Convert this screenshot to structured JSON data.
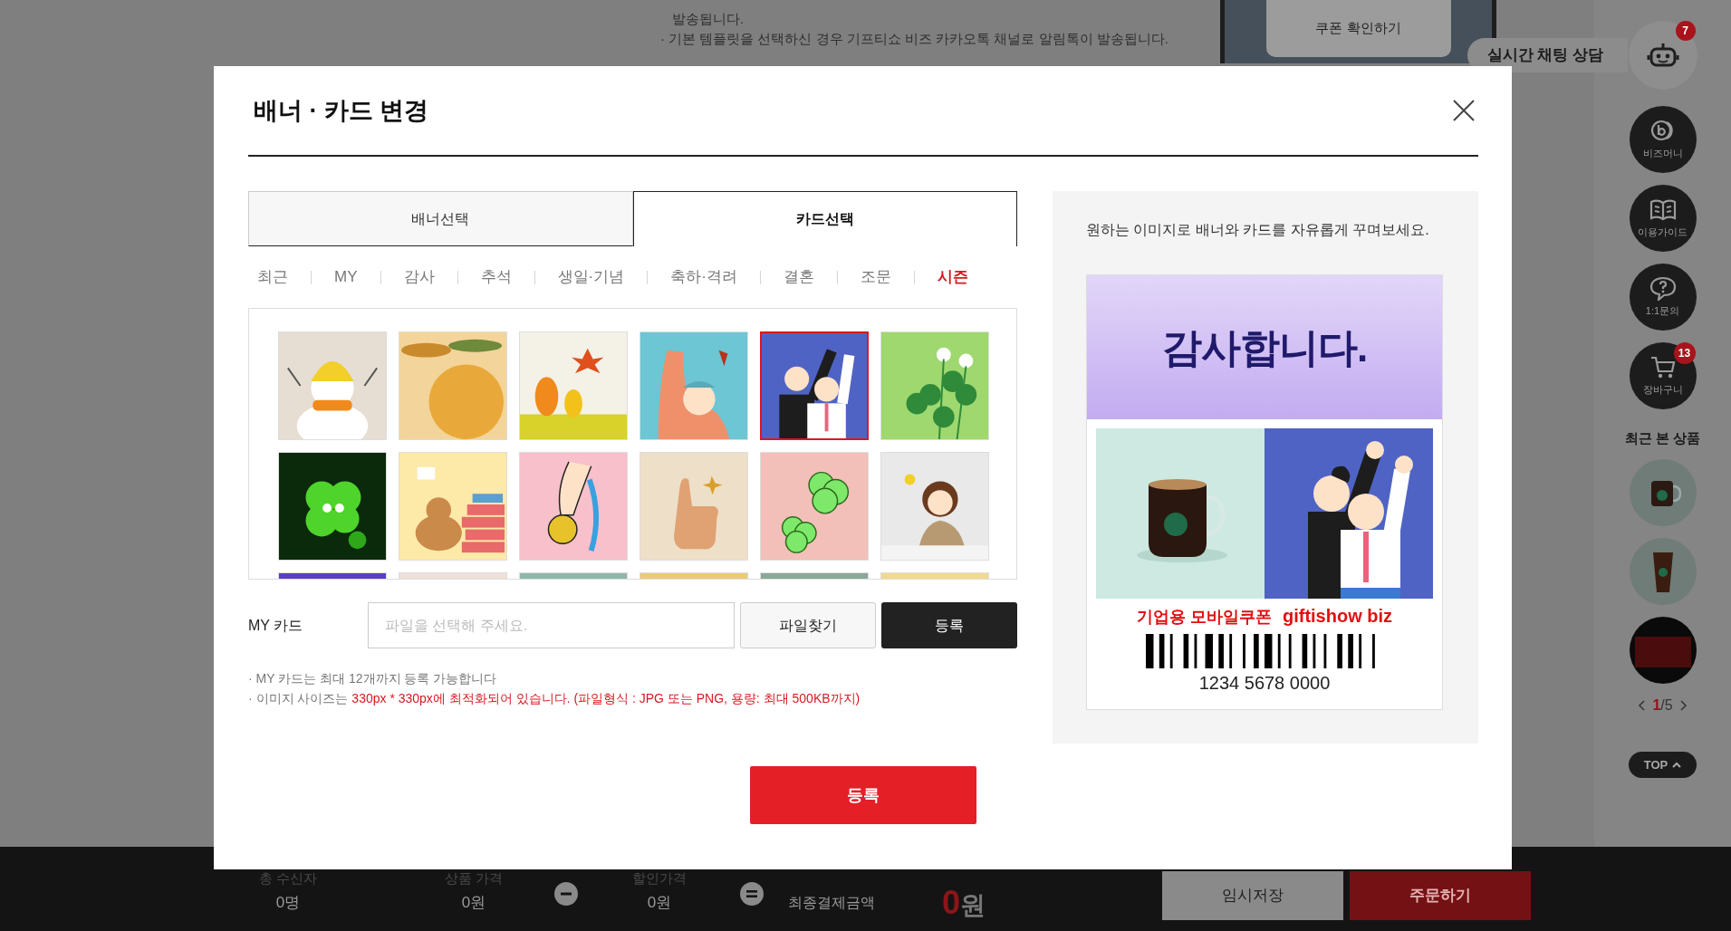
{
  "background_notice": {
    "lines": [
      "발송됩니다.",
      "· 기본 템플릿을 선택하신 경우 기프티쇼 비즈 카카오톡 채널로 알림톡이 발송됩니다."
    ],
    "coupon_check_button": "쿠폰 확인하기"
  },
  "chat": {
    "label": "실시간 채팅 상담",
    "badge": "7"
  },
  "quick_menu": [
    {
      "kind": "bizmoney",
      "label": "비즈머니"
    },
    {
      "kind": "guide",
      "label": "이용가이드"
    },
    {
      "kind": "inquiry",
      "label": "1:1문의"
    },
    {
      "kind": "cart",
      "label": "장바구니",
      "badge": "13"
    }
  ],
  "recent_products": {
    "title": "최근 본 상품",
    "items": [
      {
        "kind": "mug"
      },
      {
        "kind": "iced-coffee"
      },
      {
        "kind": "gift-card"
      }
    ],
    "pager": {
      "current": "1",
      "total": "/5"
    },
    "top_button": "TOP"
  },
  "modal": {
    "title": "배너 · 카드 변경",
    "tabs": [
      {
        "label": "배너선택",
        "selected": false
      },
      {
        "label": "카드선택",
        "selected": true
      }
    ],
    "categories": [
      {
        "label": "최근",
        "selected": false
      },
      {
        "label": "MY",
        "selected": false
      },
      {
        "label": "감사",
        "selected": false
      },
      {
        "label": "추석",
        "selected": false
      },
      {
        "label": "생일·기념",
        "selected": false
      },
      {
        "label": "축하·격려",
        "selected": false
      },
      {
        "label": "결혼",
        "selected": false
      },
      {
        "label": "조문",
        "selected": false
      },
      {
        "label": "시즌",
        "selected": true
      }
    ],
    "cards": [
      {
        "kind": "snowman",
        "selected": false
      },
      {
        "kind": "autumn-hello",
        "selected": false
      },
      {
        "kind": "autumn-trees",
        "selected": false
      },
      {
        "kind": "fist-leaf",
        "selected": false
      },
      {
        "kind": "cheering-pair",
        "selected": true
      },
      {
        "kind": "clover-field",
        "selected": false
      },
      {
        "kind": "clover-character",
        "selected": false
      },
      {
        "kind": "bear-books",
        "selected": false
      },
      {
        "kind": "medal",
        "selected": false
      },
      {
        "kind": "thumbs-up",
        "selected": false
      },
      {
        "kind": "smiling-clovers",
        "selected": false
      },
      {
        "kind": "studying-girl",
        "selected": false
      },
      {
        "kind": "violet",
        "selected": false
      },
      {
        "kind": "blush",
        "selected": false
      },
      {
        "kind": "teal",
        "selected": false
      },
      {
        "kind": "mustard",
        "selected": false
      },
      {
        "kind": "sage",
        "selected": false
      },
      {
        "kind": "sand",
        "selected": false
      }
    ],
    "my_card": {
      "label": "MY 카드",
      "placeholder": "파일을 선택해 주세요.",
      "browse_button": "파일찾기",
      "register_button": "등록"
    },
    "notes": [
      {
        "segments": [
          {
            "text": "· MY 카드는 최대 12개까지 등록 가능합니다",
            "highlight": false
          }
        ]
      },
      {
        "segments": [
          {
            "text": "· 이미지 사이즈는 ",
            "highlight": false
          },
          {
            "text": "330px * 330px에 최적화되어 있습니다. (파일형식 : JPG 또는 PNG, 용량: 최대 500KB까지)",
            "highlight": true
          }
        ]
      }
    ],
    "submit_button": "등록",
    "preview": {
      "description": "원하는 이미지로 배너와 카드를 자유롭게 꾸며보세요.",
      "banner_text": "감사합니다.",
      "coupon_brand": "기업용 모바일쿠폰",
      "coupon_logo": "giftishow biz",
      "barcode_number": "1234 5678 0000"
    }
  },
  "order_bar": {
    "items": [
      {
        "kind": "field",
        "label": "총 수신자",
        "value": "0명"
      },
      {
        "kind": "field",
        "label": "상품 가격",
        "value": "0원"
      },
      {
        "kind": "minus"
      },
      {
        "kind": "field",
        "label": "할인가격",
        "value": "0원"
      },
      {
        "kind": "equals"
      },
      {
        "kind": "total",
        "label": "최종결제금액",
        "amount": "0",
        "unit": "원"
      }
    ],
    "buttons": [
      {
        "kind": "save",
        "label": "임시저장"
      },
      {
        "kind": "order",
        "label": "주문하기"
      }
    ]
  }
}
